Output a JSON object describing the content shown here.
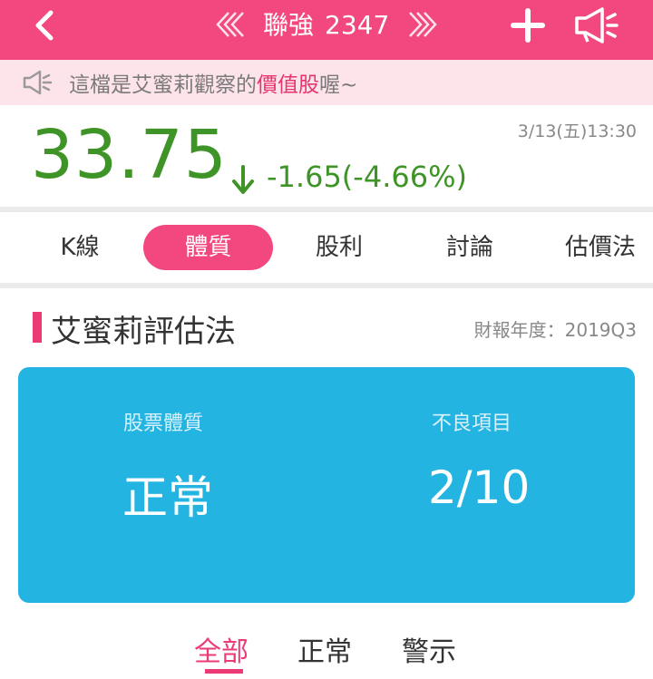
{
  "header": {
    "stock_name": "聯強",
    "stock_code": "2347",
    "back_icon": "chevron-left-icon",
    "prev_icon": "double-chevron-left-icon",
    "next_icon": "double-chevron-right-icon",
    "add_icon": "plus-icon",
    "announce_icon": "megaphone-icon",
    "color": "#f2487f"
  },
  "notice": {
    "prefix": "這檔是艾蜜莉觀察的",
    "highlight": "價值股",
    "suffix": "喔~",
    "icon": "megaphone-icon"
  },
  "quote": {
    "price": "33.75",
    "change": "-1.65(-4.66%)",
    "direction_icon": "arrow-down-icon",
    "datetime": "3/13(五)13:30",
    "color": "#3f9427"
  },
  "tabs": [
    {
      "label": "K線",
      "active": false
    },
    {
      "label": "體質",
      "active": true
    },
    {
      "label": "股利",
      "active": false
    },
    {
      "label": "討論",
      "active": false
    },
    {
      "label": "估價法",
      "active": false
    }
  ],
  "section": {
    "title": "艾蜜莉評估法",
    "report_label": "財報年度：",
    "report_period": "2019Q3"
  },
  "card": {
    "left_label": "股票體質",
    "left_value": "正常",
    "right_label": "不良項目",
    "right_value": "2/10",
    "color": "#24b4e2"
  },
  "filters": [
    {
      "label": "全部",
      "active": true
    },
    {
      "label": "正常",
      "active": false
    },
    {
      "label": "警示",
      "active": false
    }
  ]
}
